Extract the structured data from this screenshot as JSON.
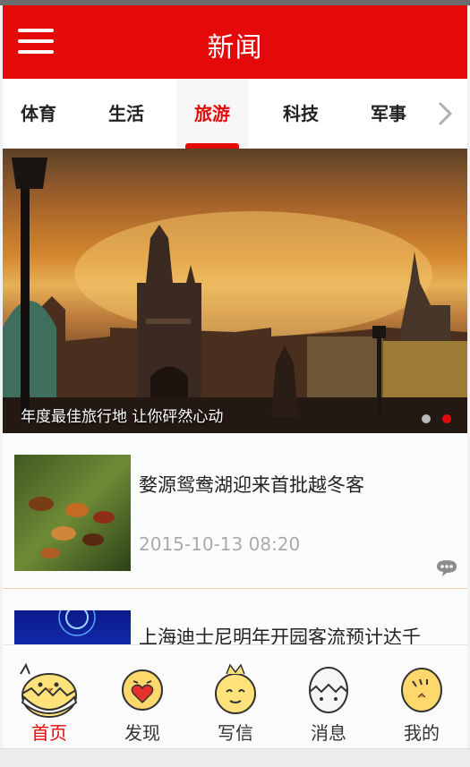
{
  "header": {
    "title": "新闻",
    "menu_icon": "menu-icon"
  },
  "tabs": [
    {
      "label": "体育",
      "active": false
    },
    {
      "label": "生活",
      "active": false
    },
    {
      "label": "旅游",
      "active": true
    },
    {
      "label": "科技",
      "active": false
    },
    {
      "label": "军事",
      "active": false
    }
  ],
  "banner": {
    "caption": "年度最佳旅行地 让你砰然心动",
    "slide_count": 2,
    "active_slide": 2
  },
  "news": [
    {
      "title": "婺源鸳鸯湖迎来首批越冬客",
      "time": "2015-10-13 08:20",
      "icon": "comment-icon"
    },
    {
      "title": "上海迪士尼明年开园客流预计达千",
      "time": ""
    }
  ],
  "bottom_nav": [
    {
      "label": "首页",
      "icon": "chick-egg-icon",
      "active": true
    },
    {
      "label": "发现",
      "icon": "chick-heart-icon",
      "active": false
    },
    {
      "label": "写信",
      "icon": "chick-crown-icon",
      "active": false
    },
    {
      "label": "消息",
      "icon": "egg-icon",
      "active": false
    },
    {
      "label": "我的",
      "icon": "chick-icon",
      "active": false
    }
  ],
  "colors": {
    "accent": "#e50a0a",
    "tab_text": "#222222",
    "muted": "#aaaaaa"
  }
}
